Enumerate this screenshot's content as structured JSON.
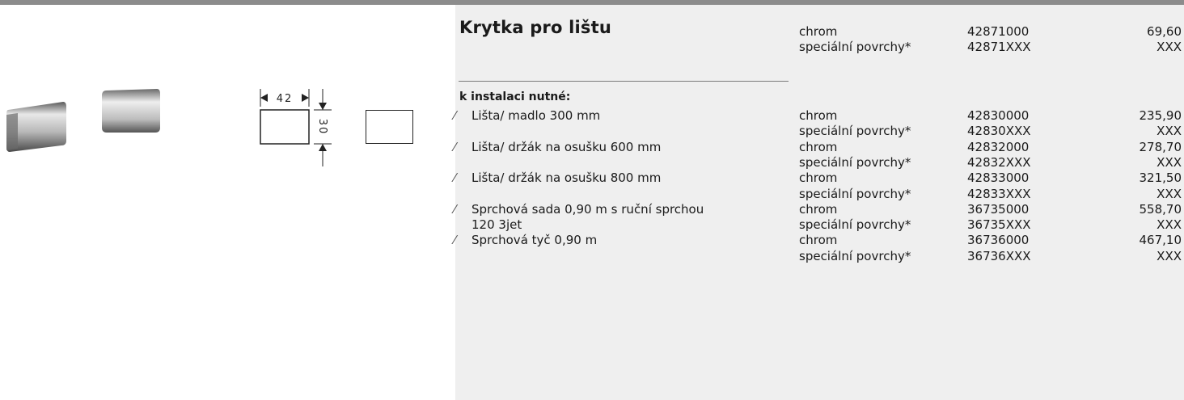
{
  "product": {
    "title": "Krytka pro lištu",
    "variants": [
      {
        "finish": "chrom",
        "code": "42871000",
        "price": "69,60"
      },
      {
        "finish": "speciální povrchy*",
        "code": "42871XXX",
        "price": "XXX"
      }
    ]
  },
  "drawing": {
    "width_label": "42",
    "height_label": "30"
  },
  "required": {
    "label": "k instalaci nutné:",
    "rows": [
      {
        "slash": "⁄",
        "desc": "Lišta/ madlo 300 mm",
        "finish": "chrom",
        "code": "42830000",
        "price": "235,90"
      },
      {
        "slash": "",
        "desc": "",
        "finish": "speciální povrchy*",
        "code": "42830XXX",
        "price": "XXX"
      },
      {
        "slash": "⁄",
        "desc": "Lišta/ držák na osušku 600 mm",
        "finish": "chrom",
        "code": "42832000",
        "price": "278,70"
      },
      {
        "slash": "",
        "desc": "",
        "finish": "speciální povrchy*",
        "code": "42832XXX",
        "price": "XXX"
      },
      {
        "slash": "⁄",
        "desc": "Lišta/ držák na osušku 800 mm",
        "finish": "chrom",
        "code": "42833000",
        "price": "321,50"
      },
      {
        "slash": "",
        "desc": "",
        "finish": "speciální povrchy*",
        "code": "42833XXX",
        "price": "XXX"
      },
      {
        "slash": "⁄",
        "desc": "Sprchová sada 0,90 m s ruční sprchou",
        "finish": "chrom",
        "code": "36735000",
        "price": "558,70"
      },
      {
        "slash": "",
        "desc": "120 3jet",
        "finish": "speciální povrchy*",
        "code": "36735XXX",
        "price": "XXX"
      },
      {
        "slash": "⁄",
        "desc": "Sprchová tyč 0,90 m",
        "finish": "chrom",
        "code": "36736000",
        "price": "467,10"
      },
      {
        "slash": "",
        "desc": "",
        "finish": "speciální povrchy*",
        "code": "36736XXX",
        "price": "XXX"
      }
    ]
  }
}
